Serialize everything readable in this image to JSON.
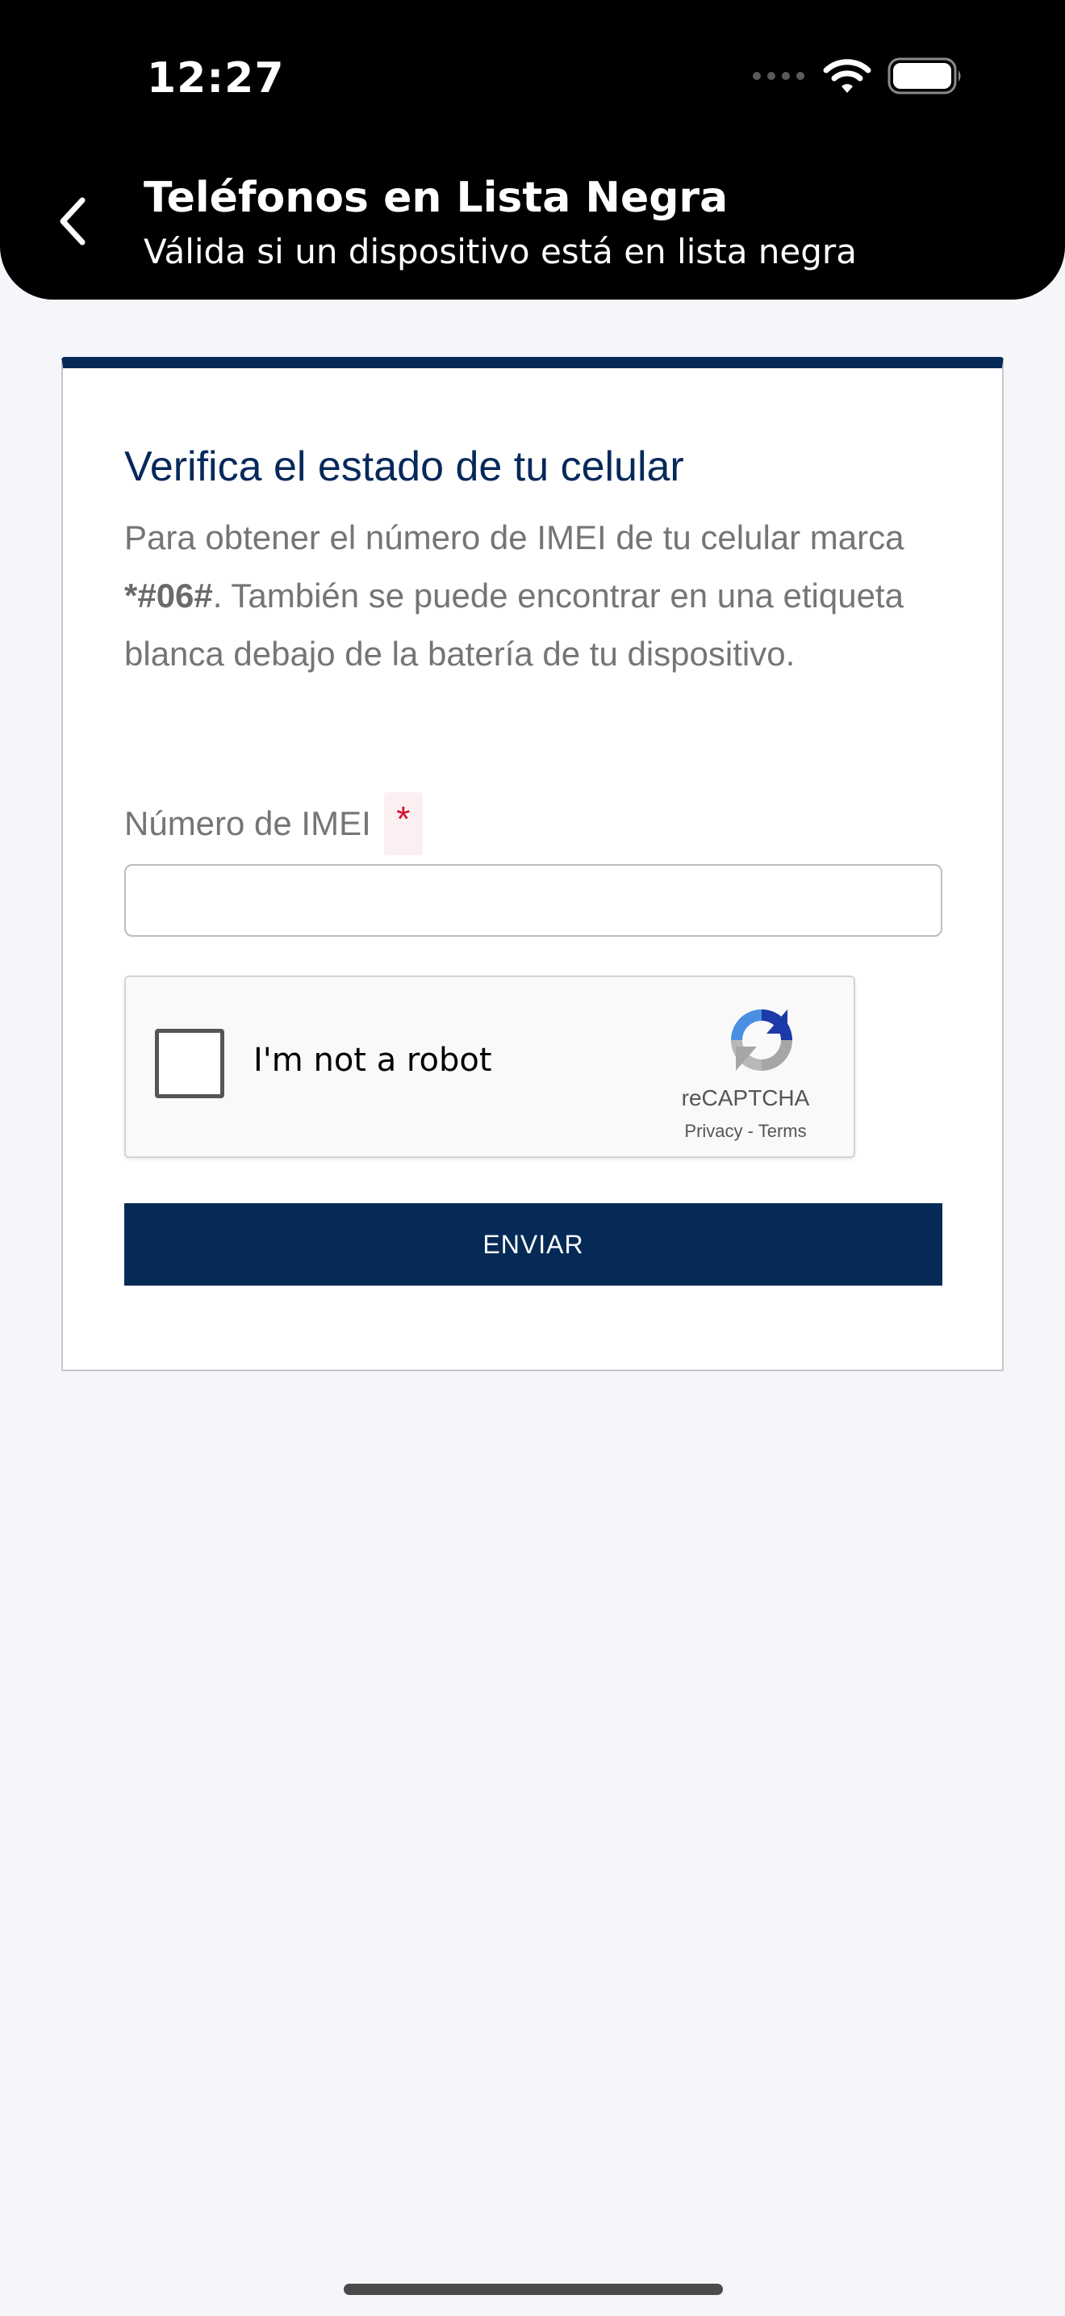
{
  "status_bar": {
    "time": "12:27",
    "icons": [
      "signal-icon",
      "wifi-icon",
      "battery-icon"
    ]
  },
  "header": {
    "back_icon": "chevron-left-icon",
    "title": "Teléfonos en Lista Negra",
    "subtitle": "Válida si un dispositivo está en lista negra"
  },
  "form": {
    "title": "Verifica el estado de tu celular",
    "description": {
      "before": "Para obtener el número de IMEI de tu celular marca ",
      "code": "*#06#",
      "after": ". También se puede encontrar en una etiqueta blanca debajo de la batería de tu dispositivo."
    },
    "imei_label": "Número de IMEI",
    "required_mark": "*",
    "imei_value": "",
    "submit_label": "ENVIAR"
  },
  "recaptcha": {
    "label": "I'm not a robot",
    "brand": "reCAPTCHA",
    "privacy": "Privacy",
    "separator": "-",
    "terms": "Terms",
    "checked": false
  },
  "colors": {
    "header_bg": "#000000",
    "page_bg": "#f5f6fa",
    "primary": "#052a56",
    "title": "#06295a",
    "muted_text": "#757575",
    "required": "#d0102e"
  }
}
